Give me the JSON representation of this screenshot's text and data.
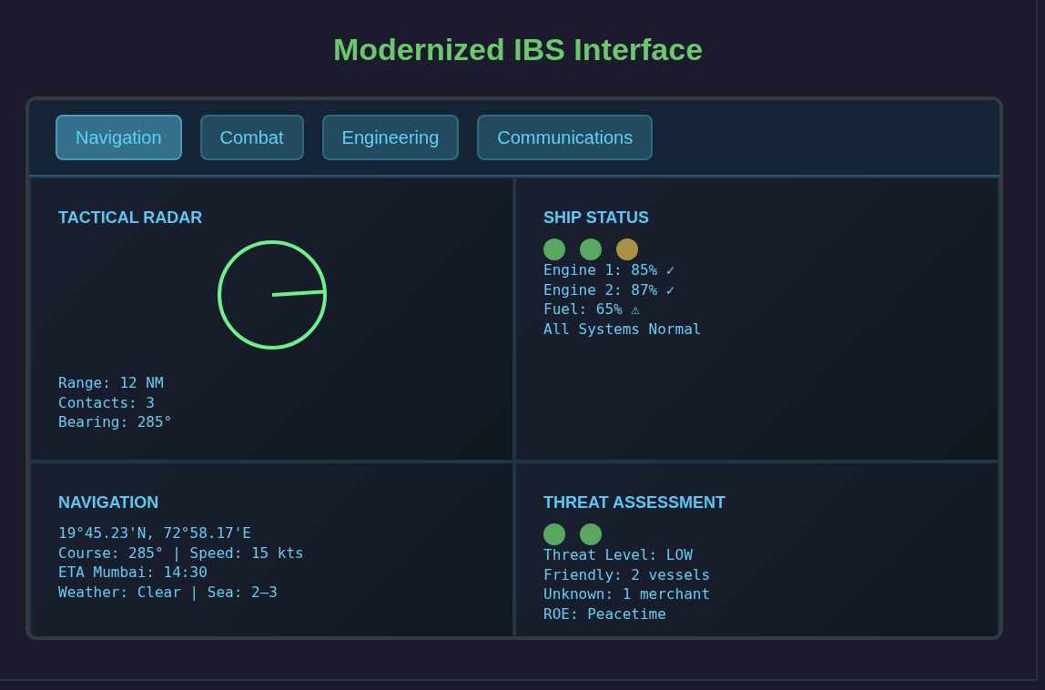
{
  "title": "Modernized IBS Interface",
  "tabs": [
    {
      "label": "Navigation",
      "selected": true
    },
    {
      "label": "Combat",
      "selected": false
    },
    {
      "label": "Engineering",
      "selected": false
    },
    {
      "label": "Communications",
      "selected": false
    }
  ],
  "panels": [
    {
      "kind": "radar",
      "title": "TACTICAL RADAR",
      "lines": [
        "Range: 12 NM",
        "Contacts: 3",
        "Bearing: 285°"
      ]
    },
    {
      "kind": "status",
      "title": "SHIP STATUS",
      "indicators": [
        {
          "color": "#58a862"
        },
        {
          "color": "#58a862"
        },
        {
          "color": "#a89248"
        }
      ],
      "lines": [
        "Engine 1: 85% ✓",
        "Engine 2: 87% ✓",
        "Fuel: 65% ⚠",
        "All Systems Normal"
      ]
    },
    {
      "kind": "text",
      "title": "NAVIGATION",
      "lines": [
        "19°45.23'N, 72°58.17'E",
        "Course: 285° | Speed: 15 kts",
        "ETA Mumbai: 14:30",
        "Weather: Clear | Sea: 2–3"
      ]
    },
    {
      "kind": "status",
      "title": "THREAT ASSESSMENT",
      "indicators": [
        {
          "color": "#58a862"
        },
        {
          "color": "#58a862"
        }
      ],
      "lines": [
        "Threat Level: LOW",
        "Friendly: 2 vessels",
        "Unknown: 1 merchant",
        "ROE: Peacetime"
      ]
    }
  ]
}
